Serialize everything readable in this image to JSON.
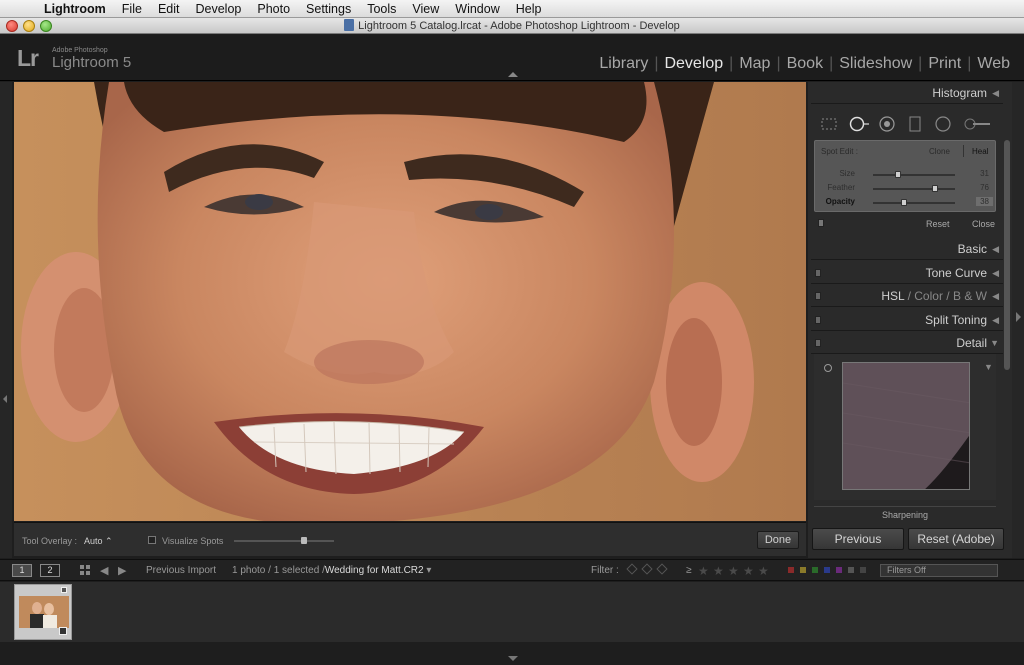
{
  "menubar": {
    "app": "Lightroom",
    "items": [
      "File",
      "Edit",
      "Develop",
      "Photo",
      "Settings",
      "Tools",
      "View",
      "Window",
      "Help"
    ]
  },
  "window": {
    "title": "Lightroom 5 Catalog.lrcat - Adobe Photoshop Lightroom - Develop"
  },
  "logo": {
    "mark": "Lr",
    "sub": "Adobe Photoshop",
    "name": "Lightroom 5"
  },
  "modules": {
    "items": [
      "Library",
      "Develop",
      "Map",
      "Book",
      "Slideshow",
      "Print",
      "Web"
    ],
    "active": "Develop"
  },
  "toolbar": {
    "overlay_label": "Tool Overlay :",
    "overlay_value": "Auto",
    "visualize_label": "Visualize Spots",
    "visualize_level": 0.7,
    "done_label": "Done"
  },
  "panel": {
    "histogram": "Histogram",
    "spot": {
      "label": "Spot Edit :",
      "clone": "Clone",
      "heal": "Heal",
      "sliders": [
        {
          "name": "Size",
          "value": "31",
          "level": 0.31
        },
        {
          "name": "Feather",
          "value": "76",
          "level": 0.76
        },
        {
          "name": "Opacity",
          "value": "38",
          "level": 0.38
        }
      ],
      "reset": "Reset",
      "close": "Close"
    },
    "basic": "Basic",
    "tone_curve": "Tone Curve",
    "hsl": {
      "a": "HSL",
      "sep": "/",
      "b": "Color",
      "c": "B & W"
    },
    "split_toning": "Split Toning",
    "detail": "Detail",
    "sharpening": "Sharpening"
  },
  "buttons": {
    "previous": "Previous",
    "reset": "Reset (Adobe)"
  },
  "filmbar": {
    "monitor1": "1",
    "monitor2": "2",
    "source": "Previous Import",
    "count": "1 photo / 1 selected /",
    "file": "Wedding for Matt.CR2",
    "filter_label": "Filter :",
    "ge": "≥",
    "filters_off": "Filters Off"
  },
  "colors": {
    "accent": "#e6e6e6",
    "panel_bg": "#2a2a2a",
    "spot_box": "#565656"
  }
}
